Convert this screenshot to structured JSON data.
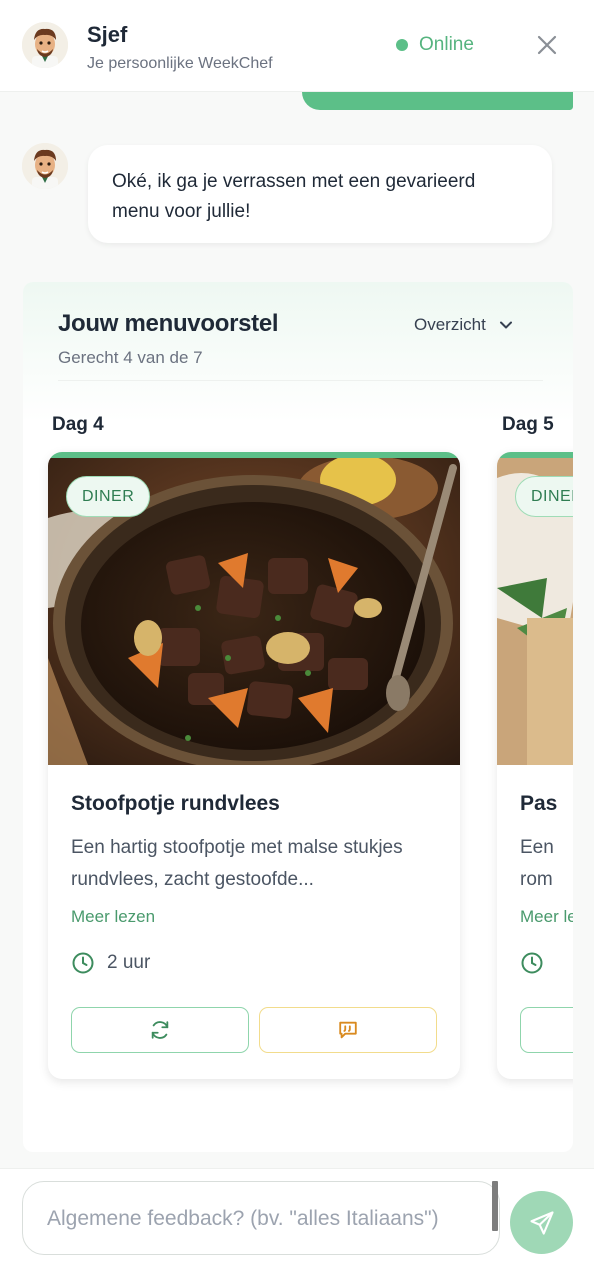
{
  "header": {
    "bot_name": "Sjef",
    "bot_subtitle": "Je persoonlijke WeekChef",
    "status": "Online",
    "avatar_icon": "chef-avatar",
    "close_icon": "close-icon"
  },
  "conversation": {
    "bot_message": "Oké, ik ga je verrassen met een gevarieerd menu voor jullie!"
  },
  "menu": {
    "title": "Jouw menuvoorstel",
    "subtitle": "Gerecht 4 van de 7",
    "view_selector": "Overzicht",
    "cards": [
      {
        "day": "Dag 4",
        "meal_type": "DINER",
        "title": "Stoofpotje rundvlees",
        "description": "Een hartig stoofpotje met malse stukjes rundvlees, zacht gestoofde...",
        "read_more": "Meer lezen",
        "time": "2 uur"
      },
      {
        "day": "Dag 5",
        "meal_type": "DINER",
        "title": "Pas",
        "description": "Een rom",
        "read_more": "Meer lezen",
        "time": ""
      }
    ]
  },
  "composer": {
    "placeholder": "Algemene feedback? (bv. \"alles Italiaans\")"
  },
  "colors": {
    "brand_green": "#5cbf88",
    "feedback_yellow": "#f2dc8c"
  }
}
